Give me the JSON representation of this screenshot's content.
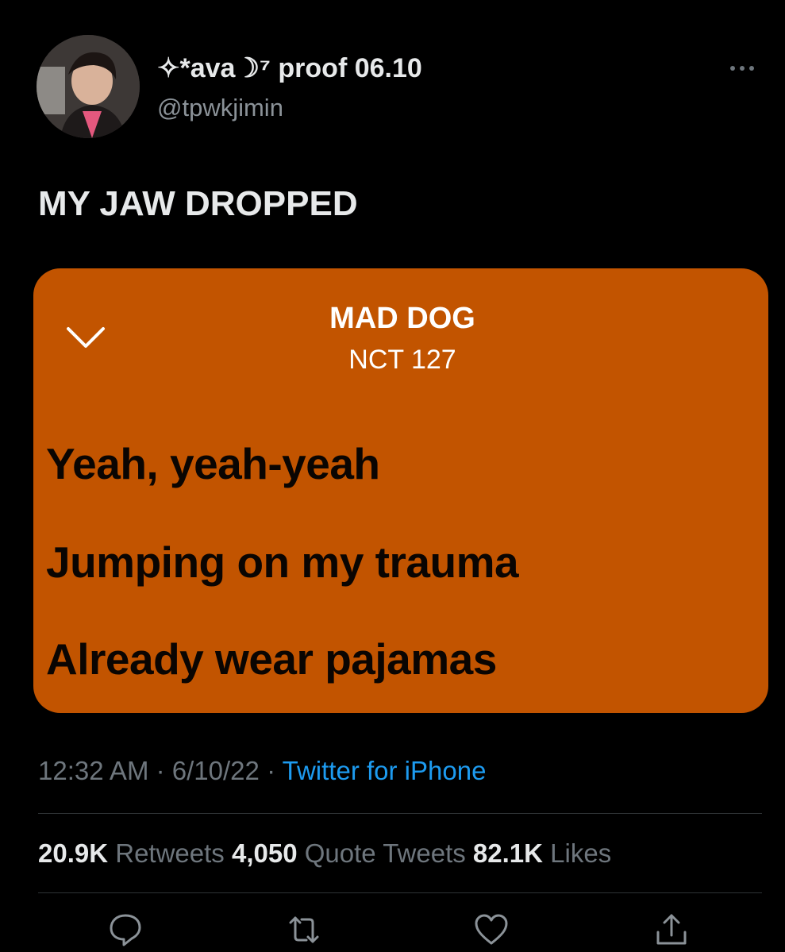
{
  "author": {
    "display_name": "✧*ava☽⁷ proof 06.10",
    "handle": "@tpwkjimin"
  },
  "tweet": {
    "text": "MY JAW DROPPED"
  },
  "lyrics_card": {
    "song_title": "MAD DOG",
    "artist": "NCT 127",
    "lines": [
      "Yeah, yeah-yeah",
      "Jumping on my trauma",
      "Already wear pajamas"
    ],
    "background_color": "#c25400"
  },
  "meta": {
    "time": "12:32 AM",
    "date": "6/10/22",
    "separator": "·",
    "source": "Twitter for iPhone"
  },
  "stats": {
    "retweets_count": "20.9K",
    "retweets_label": "Retweets",
    "quote_count": "4,050",
    "quote_label": "Quote Tweets",
    "likes_count": "82.1K",
    "likes_label": "Likes"
  },
  "icons": {
    "more": "more-horizontal-icon",
    "chevron": "chevron-down-icon",
    "reply": "reply-icon",
    "retweet": "retweet-icon",
    "like": "heart-icon",
    "share": "share-icon"
  },
  "colors": {
    "background": "#000000",
    "text_primary": "#e7e9ea",
    "text_secondary": "#6e767d",
    "link": "#1d9bf0"
  }
}
